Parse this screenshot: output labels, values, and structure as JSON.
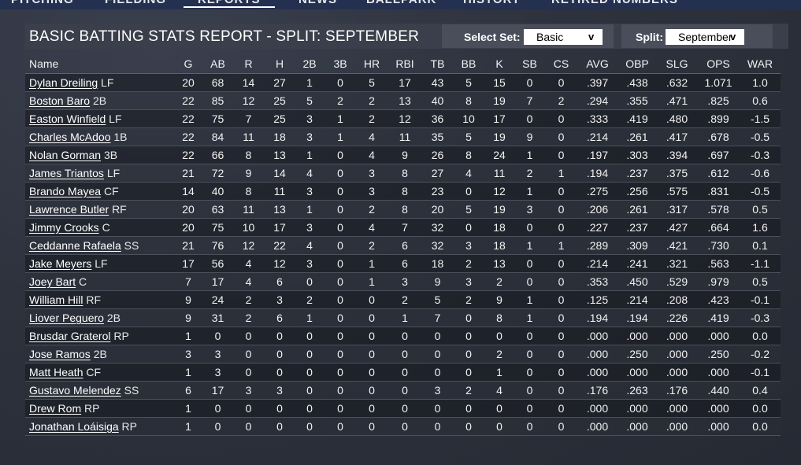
{
  "nav": {
    "items": [
      "PITCHING",
      "FIELDING",
      "REPORTS",
      "NEWS",
      "BALLPARK",
      "HISTORY",
      "RETIRED NUMBERS"
    ],
    "active": "REPORTS"
  },
  "report": {
    "title": "BASIC BATTING STATS REPORT - SPLIT: SEPTEMBER",
    "select_set_label": "Select Set:",
    "select_set_value": "Basic",
    "split_label": "Split:",
    "split_value": "September"
  },
  "table": {
    "columns": [
      "Name",
      "G",
      "AB",
      "R",
      "H",
      "2B",
      "3B",
      "HR",
      "RBI",
      "TB",
      "BB",
      "K",
      "SB",
      "CS",
      "AVG",
      "OBP",
      "SLG",
      "OPS",
      "WAR"
    ],
    "rows": [
      {
        "name": "Dylan Dreiling",
        "pos": "LF",
        "stats": [
          "20",
          "68",
          "14",
          "27",
          "1",
          "0",
          "5",
          "17",
          "43",
          "5",
          "15",
          "0",
          "0",
          ".397",
          ".438",
          ".632",
          "1.071",
          "1.0"
        ]
      },
      {
        "name": "Boston Baro",
        "pos": "2B",
        "stats": [
          "22",
          "85",
          "12",
          "25",
          "5",
          "2",
          "2",
          "13",
          "40",
          "8",
          "19",
          "7",
          "2",
          ".294",
          ".355",
          ".471",
          ".825",
          "0.6"
        ]
      },
      {
        "name": "Easton Winfield",
        "pos": "LF",
        "stats": [
          "22",
          "75",
          "7",
          "25",
          "3",
          "1",
          "2",
          "12",
          "36",
          "10",
          "17",
          "0",
          "0",
          ".333",
          ".419",
          ".480",
          ".899",
          "-1.5"
        ]
      },
      {
        "name": "Charles McAdoo",
        "pos": "1B",
        "stats": [
          "22",
          "84",
          "11",
          "18",
          "3",
          "1",
          "4",
          "11",
          "35",
          "5",
          "19",
          "9",
          "0",
          ".214",
          ".261",
          ".417",
          ".678",
          "-0.5"
        ]
      },
      {
        "name": "Nolan Gorman",
        "pos": "3B",
        "stats": [
          "22",
          "66",
          "8",
          "13",
          "1",
          "0",
          "4",
          "9",
          "26",
          "8",
          "24",
          "1",
          "0",
          ".197",
          ".303",
          ".394",
          ".697",
          "-0.3"
        ]
      },
      {
        "name": "James Triantos",
        "pos": "LF",
        "stats": [
          "21",
          "72",
          "9",
          "14",
          "4",
          "0",
          "3",
          "8",
          "27",
          "4",
          "11",
          "2",
          "1",
          ".194",
          ".237",
          ".375",
          ".612",
          "-0.6"
        ]
      },
      {
        "name": "Brando Mayea",
        "pos": "CF",
        "stats": [
          "14",
          "40",
          "8",
          "11",
          "3",
          "0",
          "3",
          "8",
          "23",
          "0",
          "12",
          "1",
          "0",
          ".275",
          ".256",
          ".575",
          ".831",
          "-0.5"
        ]
      },
      {
        "name": "Lawrence Butler",
        "pos": "RF",
        "stats": [
          "20",
          "63",
          "11",
          "13",
          "1",
          "0",
          "2",
          "8",
          "20",
          "5",
          "19",
          "3",
          "0",
          ".206",
          ".261",
          ".317",
          ".578",
          "0.5"
        ]
      },
      {
        "name": "Jimmy Crooks",
        "pos": "C",
        "stats": [
          "20",
          "75",
          "10",
          "17",
          "3",
          "0",
          "4",
          "7",
          "32",
          "0",
          "18",
          "0",
          "0",
          ".227",
          ".237",
          ".427",
          ".664",
          "1.6"
        ]
      },
      {
        "name": "Ceddanne Rafaela",
        "pos": "SS",
        "stats": [
          "21",
          "76",
          "12",
          "22",
          "4",
          "0",
          "2",
          "6",
          "32",
          "3",
          "18",
          "1",
          "1",
          ".289",
          ".309",
          ".421",
          ".730",
          "0.1"
        ]
      },
      {
        "name": "Jake Meyers",
        "pos": "LF",
        "stats": [
          "17",
          "56",
          "4",
          "12",
          "3",
          "0",
          "1",
          "6",
          "18",
          "2",
          "13",
          "0",
          "0",
          ".214",
          ".241",
          ".321",
          ".563",
          "-1.1"
        ]
      },
      {
        "name": "Joey Bart",
        "pos": "C",
        "stats": [
          "7",
          "17",
          "4",
          "6",
          "0",
          "0",
          "1",
          "3",
          "9",
          "3",
          "2",
          "0",
          "0",
          ".353",
          ".450",
          ".529",
          ".979",
          "0.5"
        ]
      },
      {
        "name": "William Hill",
        "pos": "RF",
        "stats": [
          "9",
          "24",
          "2",
          "3",
          "2",
          "0",
          "0",
          "2",
          "5",
          "2",
          "9",
          "1",
          "0",
          ".125",
          ".214",
          ".208",
          ".423",
          "-0.1"
        ]
      },
      {
        "name": "Liover Peguero",
        "pos": "2B",
        "stats": [
          "9",
          "31",
          "2",
          "6",
          "1",
          "0",
          "0",
          "1",
          "7",
          "0",
          "8",
          "1",
          "0",
          ".194",
          ".194",
          ".226",
          ".419",
          "-0.3"
        ]
      },
      {
        "name": "Brusdar Graterol",
        "pos": "RP",
        "stats": [
          "1",
          "0",
          "0",
          "0",
          "0",
          "0",
          "0",
          "0",
          "0",
          "0",
          "0",
          "0",
          "0",
          ".000",
          ".000",
          ".000",
          ".000",
          "0.0"
        ]
      },
      {
        "name": "Jose Ramos",
        "pos": "2B",
        "stats": [
          "3",
          "3",
          "0",
          "0",
          "0",
          "0",
          "0",
          "0",
          "0",
          "0",
          "2",
          "0",
          "0",
          ".000",
          ".250",
          ".000",
          ".250",
          "-0.2"
        ]
      },
      {
        "name": "Matt Heath",
        "pos": "CF",
        "stats": [
          "1",
          "3",
          "0",
          "0",
          "0",
          "0",
          "0",
          "0",
          "0",
          "0",
          "1",
          "0",
          "0",
          ".000",
          ".000",
          ".000",
          ".000",
          "-0.1"
        ]
      },
      {
        "name": "Gustavo Melendez",
        "pos": "SS",
        "stats": [
          "6",
          "17",
          "3",
          "3",
          "0",
          "0",
          "0",
          "0",
          "3",
          "2",
          "4",
          "0",
          "0",
          ".176",
          ".263",
          ".176",
          ".440",
          "0.4"
        ]
      },
      {
        "name": "Drew Rom",
        "pos": "RP",
        "stats": [
          "1",
          "0",
          "0",
          "0",
          "0",
          "0",
          "0",
          "0",
          "0",
          "0",
          "0",
          "0",
          "0",
          ".000",
          ".000",
          ".000",
          ".000",
          "0.0"
        ]
      },
      {
        "name": "Jonathan Loáisiga",
        "pos": "RP",
        "stats": [
          "1",
          "0",
          "0",
          "0",
          "0",
          "0",
          "0",
          "0",
          "0",
          "0",
          "0",
          "0",
          "0",
          ".000",
          ".000",
          ".000",
          ".000",
          "0.0"
        ]
      }
    ]
  }
}
